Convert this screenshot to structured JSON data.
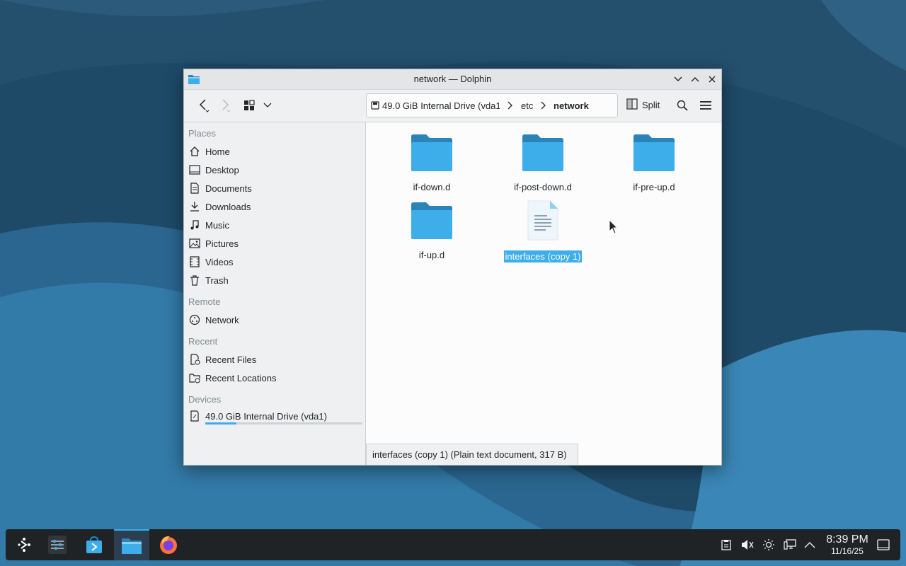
{
  "window": {
    "title": "network — Dolphin",
    "toolbar": {
      "breadcrumb": [
        "49.0 GiB Internal Drive (vda1)",
        "etc",
        "network"
      ],
      "split_label": "Split"
    }
  },
  "sidebar": {
    "places_header": "Places",
    "places": [
      {
        "label": "Home",
        "icon": "home-icon"
      },
      {
        "label": "Desktop",
        "icon": "desktop-icon"
      },
      {
        "label": "Documents",
        "icon": "documents-icon"
      },
      {
        "label": "Downloads",
        "icon": "downloads-icon"
      },
      {
        "label": "Music",
        "icon": "music-icon"
      },
      {
        "label": "Pictures",
        "icon": "pictures-icon"
      },
      {
        "label": "Videos",
        "icon": "videos-icon"
      },
      {
        "label": "Trash",
        "icon": "trash-icon"
      }
    ],
    "remote_header": "Remote",
    "remote": [
      {
        "label": "Network",
        "icon": "network-icon"
      }
    ],
    "recent_header": "Recent",
    "recent": [
      {
        "label": "Recent Files",
        "icon": "recent-files-icon"
      },
      {
        "label": "Recent Locations",
        "icon": "recent-locations-icon"
      }
    ],
    "devices_header": "Devices",
    "devices": [
      {
        "label": "49.0 GiB Internal Drive (vda1)",
        "icon": "drive-icon",
        "usage_fraction": 0.2
      }
    ]
  },
  "files": [
    {
      "name": "if-down.d",
      "type": "folder",
      "selected": false
    },
    {
      "name": "if-post-down.d",
      "type": "folder",
      "selected": false
    },
    {
      "name": "if-pre-up.d",
      "type": "folder",
      "selected": false
    },
    {
      "name": "if-up.d",
      "type": "folder",
      "selected": false
    },
    {
      "name": "interfaces (copy 1)",
      "type": "text-file",
      "selected": true
    }
  ],
  "statusbar": {
    "text": "interfaces (copy 1) (Plain text document, 317 B)"
  },
  "taskbar": {
    "apps": [
      "application-launcher-icon",
      "system-settings-icon",
      "discover-icon",
      "dolphin-icon",
      "firefox-icon"
    ],
    "tray": [
      "clipboard-icon",
      "volume-muted-icon",
      "brightness-icon",
      "network-status-icon",
      "tray-expand-icon"
    ],
    "clock": {
      "time": "8:39 PM",
      "date": "11/16/25"
    }
  },
  "colors": {
    "accent": "#3daee9",
    "folder": "#3daee9",
    "folder_tab": "#2a84b8",
    "taskbar": "#1f2326"
  }
}
